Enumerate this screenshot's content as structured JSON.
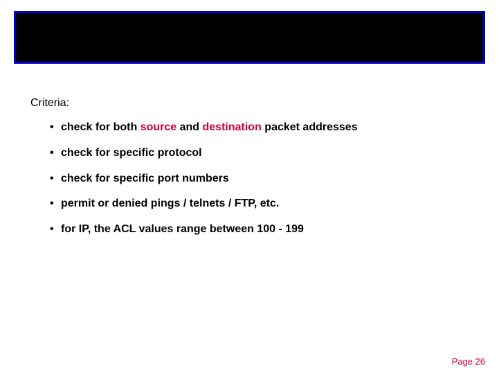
{
  "criteria_label": "Criteria:",
  "bullets": {
    "b0": {
      "pre": "check for both ",
      "kw1": "source",
      "mid": " and ",
      "kw2": "destination",
      "post": " packet addresses"
    },
    "b1": "check for specific protocol",
    "b2": "check for specific port numbers",
    "b3": "permit or denied pings / telnets / FTP, etc.",
    "b4": "for IP, the ACL values range between 100 - 199"
  },
  "page_number": "Page 26"
}
